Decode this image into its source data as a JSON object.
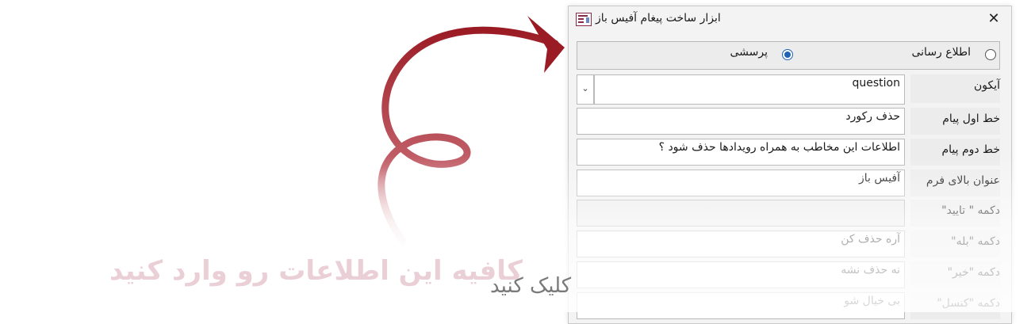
{
  "dialog": {
    "title": "ابزار ساخت پیغام آفیس باز",
    "close_glyph": "✕",
    "app_icon": "form-icon"
  },
  "message_type": {
    "options": [
      {
        "label": "اطلاع رسانی",
        "checked": false
      },
      {
        "label": "پرسشی",
        "checked": true
      }
    ]
  },
  "form": {
    "rows": [
      {
        "label": "آیکون",
        "value": "question",
        "type": "combo"
      },
      {
        "label": "خط اول پیام",
        "value": "حذف رکورد",
        "type": "text"
      },
      {
        "label": "خط دوم پیام",
        "value": "اطلاعات این مخاطب به همراه رویدادها حذف شود ؟",
        "type": "text"
      },
      {
        "label": "عنوان بالای فرم",
        "value": "آفیس باز",
        "type": "text"
      },
      {
        "label": "دکمه \" تایید\"",
        "value": "",
        "type": "disabled"
      },
      {
        "label": "دکمه \"بله\"",
        "value": "آره حذف کن",
        "type": "text"
      },
      {
        "label": "دکمه \"خیر\"",
        "value": "نه حذف نشه",
        "type": "text"
      },
      {
        "label": "دکمه \"کنسل\"",
        "value": "بی خیال شو",
        "type": "text"
      }
    ],
    "dropdown_glyph": "⌄"
  },
  "overlay": {
    "instruction": "کافیه این اطلاعات رو وارد کنید",
    "click_hint": "کلیک کنید",
    "arrow_color": "#9b1b24"
  }
}
